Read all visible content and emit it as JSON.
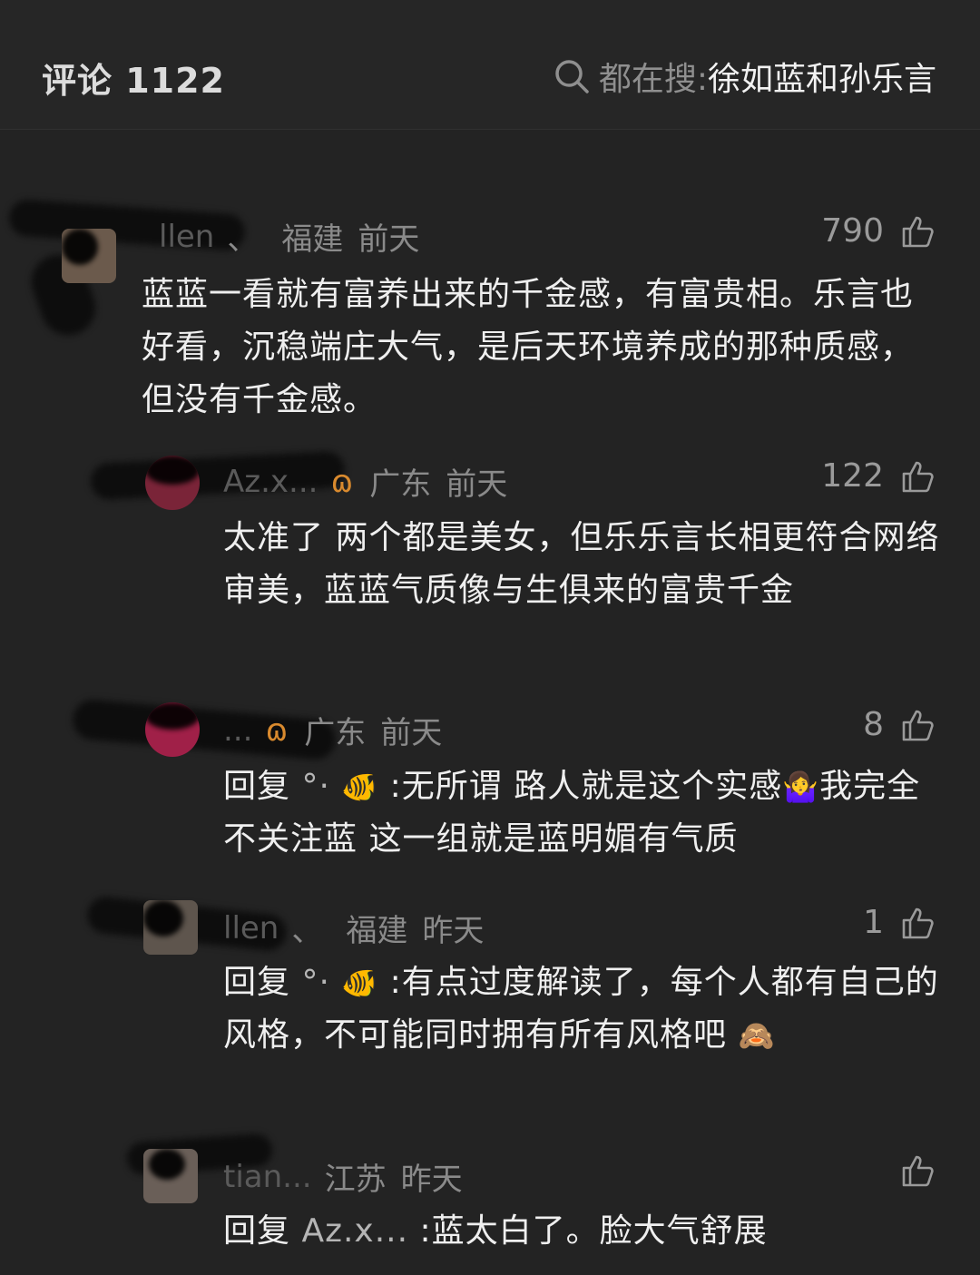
{
  "header": {
    "title": "评论 1122",
    "search_prefix": "都在搜: ",
    "search_term": "徐如蓝和孙乐言"
  },
  "comments": [
    {
      "name": "llen",
      "separator": "、",
      "location": "福建",
      "time": "前天",
      "likes": "790",
      "text": "蓝蓝一看就有富养出来的千金感，有富贵相。乐言也好看，沉稳端庄大气，是后天环境养成的那种质感，但没有千金感。"
    },
    {
      "name": "Az.x...",
      "mark": "ɷ",
      "location": "广东",
      "time": "前天",
      "likes": "122",
      "text": "太准了 两个都是美女，但乐乐言长相更符合网络审美，蓝蓝气质像与生俱来的富贵千金"
    },
    {
      "name": "...",
      "mark": "ɷ",
      "location": "广东",
      "time": "前天",
      "likes": "8",
      "reply_prefix": "回复",
      "reply_to": "°·",
      "reply_emoji": "🐠",
      "text": ":无所谓 路人就是这个实感",
      "trail_emoji": "🤷‍♀️",
      "text2": "我完全不关注蓝 这一组就是蓝明媚有气质"
    },
    {
      "name": "llen",
      "separator": "、",
      "location": "福建",
      "time": "昨天",
      "likes": "1",
      "reply_prefix": "回复",
      "reply_to": "°·",
      "reply_emoji": "🐠",
      "text": ":有点过度解读了，每个人都有自己的风格，不可能同时拥有所有风格吧",
      "trail_emoji": "🙈"
    },
    {
      "name": "tian...",
      "location": "江苏",
      "time": "昨天",
      "likes": "",
      "reply_prefix": "回复",
      "reply_to": "Az.x...",
      "text": ":蓝太白了。脸大气舒展"
    }
  ],
  "icons": {
    "search": "search-icon",
    "like": "thumbs-up-icon"
  }
}
